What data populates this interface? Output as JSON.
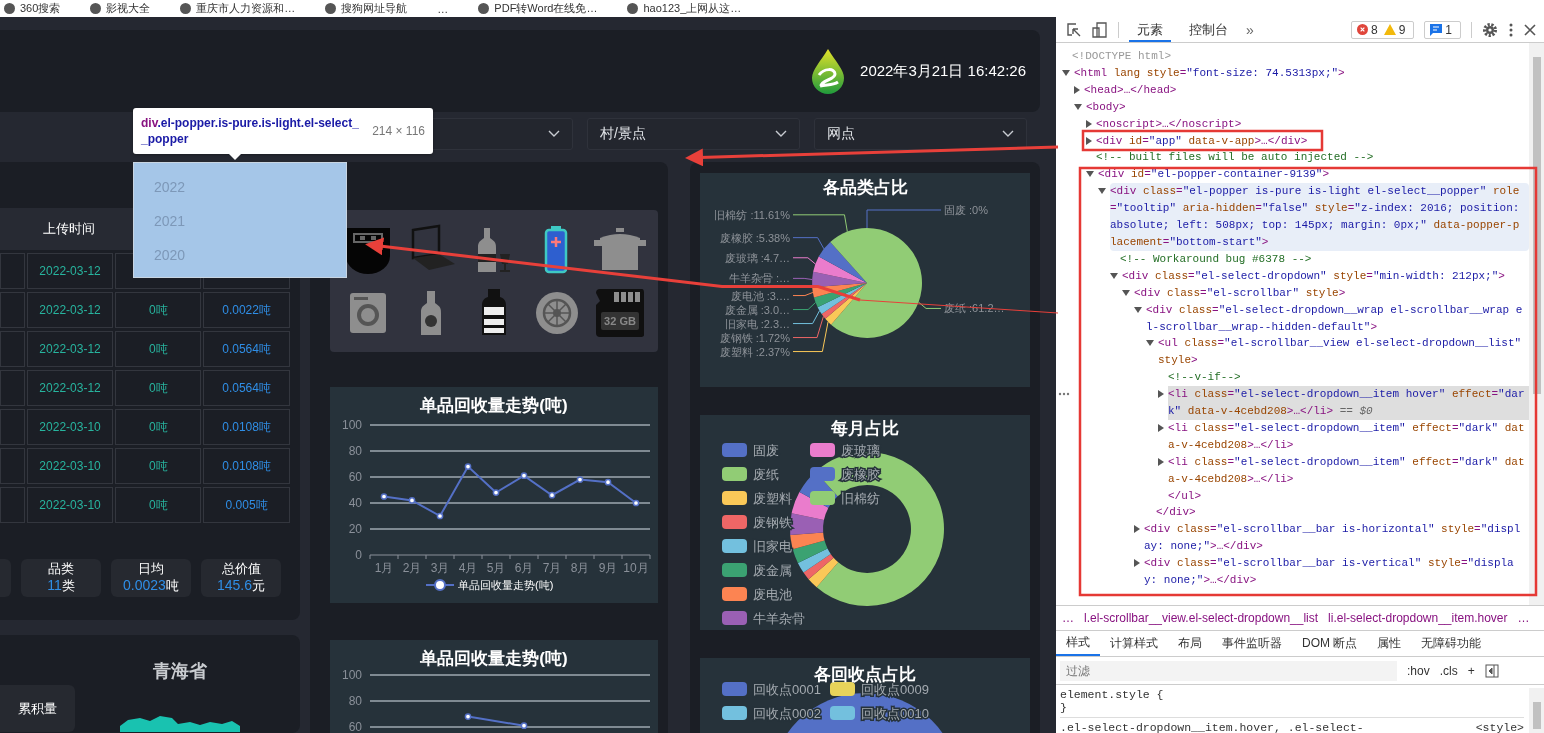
{
  "bookmarks": [
    {
      "label": "360搜索",
      "icon": true
    },
    {
      "label": "影视大全",
      "icon": true
    },
    {
      "label": "重庆市人力资源和…",
      "icon": true
    },
    {
      "label": "搜狗网址导航",
      "icon": true
    },
    {
      "label": "…",
      "icon": false
    },
    {
      "label": "PDF转Word在线免…",
      "icon": true
    },
    {
      "label": "hao123_上网从这…",
      "icon": true
    }
  ],
  "header": {
    "datetime": "2022年3月21日 16:42:26"
  },
  "filters": [
    {
      "kind": "blank"
    },
    {
      "kind": "blank"
    },
    {
      "kind": "text",
      "value": "村/景点"
    },
    {
      "kind": "text",
      "value": "网点"
    }
  ],
  "inspect_tooltip": {
    "selector": "div.el-popper.is-pure.is-light.el-select__popper",
    "size": "214 × 116"
  },
  "year_dropdown": {
    "options": [
      {
        "label": "2022",
        "selected": false
      },
      {
        "label": "2021",
        "selected": false
      },
      {
        "label": "2020",
        "selected": false
      }
    ]
  },
  "upload_table": {
    "columns": [
      "上传时间"
    ],
    "rows": [
      {
        "cells": [
          "2022-03-12"
        ]
      },
      {
        "cells": [
          "2022-03-12",
          "0吨",
          "0.0022吨"
        ]
      },
      {
        "cells": [
          "2022-03-12",
          "0吨",
          "0.0564吨"
        ]
      },
      {
        "cells": [
          "2022-03-12",
          "0吨",
          "0.0564吨"
        ]
      },
      {
        "cells": [
          "2022-03-10",
          "0吨",
          "0.0108吨"
        ]
      },
      {
        "cells": [
          "2022-03-10",
          "0吨",
          "0.0108吨"
        ]
      },
      {
        "cells": [
          "2022-03-10",
          "0吨",
          "0.005吨"
        ]
      }
    ]
  },
  "stats": [
    {
      "kind": "blank"
    },
    {
      "kind": "stat",
      "label": "品类",
      "value": "11",
      "unit": "类"
    },
    {
      "kind": "stat",
      "label": "日均",
      "value": "0.0023",
      "unit": "吨"
    },
    {
      "kind": "stat",
      "label": "总价值",
      "value": "145.6",
      "unit": "元"
    }
  ],
  "map_panel": {
    "title": "青海省",
    "button": "累积量"
  },
  "category_icons": [
    {
      "kind": "drive"
    },
    {
      "kind": "laptop"
    },
    {
      "kind": "bottle-glass"
    },
    {
      "kind": "battery"
    },
    {
      "kind": "pot"
    },
    {
      "kind": "washer"
    },
    {
      "kind": "bottle"
    },
    {
      "kind": "water-bottle"
    },
    {
      "kind": "tire"
    },
    {
      "kind": "sdcard",
      "label": "32 GB"
    }
  ],
  "trend_charts": [
    {
      "chart_data": {
        "type": "line",
        "title": "单品回收量走势(吨)",
        "categories": [
          "1月",
          "2月",
          "3月",
          "4月",
          "5月",
          "6月",
          "7月",
          "8月",
          "9月",
          "10月"
        ],
        "ylim": [
          0,
          100
        ],
        "yticks": [
          0,
          20,
          40,
          60,
          80,
          100
        ],
        "grid": true,
        "series": [
          {
            "name": "单品回收量走势(吨)",
            "color": "#5470c6",
            "marker": true,
            "values": [
              45,
              42,
              30,
              68,
              48,
              61,
              46,
              58,
              56,
              40
            ]
          }
        ]
      }
    },
    {
      "chart_data": {
        "type": "line",
        "title": "单品回收量走势(吨)",
        "ylim": [
          60,
          100
        ],
        "yticks": [
          60,
          80,
          100
        ],
        "grid": true,
        "series": [
          {
            "color": "#5470c6",
            "marker": true,
            "values": [
              null,
              null,
              null,
              68,
              null,
              61,
              null,
              null,
              null,
              null
            ]
          }
        ]
      }
    }
  ],
  "category_pie": {
    "chart_data": {
      "type": "pie",
      "title": "各品类占比",
      "values": [
        0,
        61.2,
        2.37,
        1.72,
        2.3,
        3.0,
        3.0,
        4.5,
        4.7,
        5.38,
        11.61
      ],
      "colors": [
        "#5470c6",
        "#91cc75",
        "#fac858",
        "#ee6666",
        "#73c0de",
        "#3ba272",
        "#fc8452",
        "#9a60b4",
        "#ea7ccc",
        "#5470c6",
        "#91cc75"
      ],
      "value_labels": [
        "固废 :0%",
        "废纸 :61.2…",
        "废塑料 :2.37%",
        "废钢铁 :1.72%",
        "旧家电 :2.3…",
        "废金属 :3.0…",
        "废电池 :3.…",
        "牛羊杂骨 :…",
        "废玻璃 :4.7…",
        "废橡胶 :5.38%",
        "旧棉纺 :11.61%"
      ]
    }
  },
  "monthly_donut": {
    "title": "每月占比",
    "legend": [
      {
        "label": "固废",
        "color": "#5470c6"
      },
      {
        "label": "废纸",
        "color": "#91cc75"
      },
      {
        "label": "废塑料",
        "color": "#fac858"
      },
      {
        "label": "废钢铁",
        "color": "#ee6666"
      },
      {
        "label": "旧家电",
        "color": "#73c0de"
      },
      {
        "label": "废金属",
        "color": "#3ba272"
      },
      {
        "label": "废电池",
        "color": "#fc8452"
      },
      {
        "label": "牛羊杂骨",
        "color": "#9a60b4"
      },
      {
        "label": "废玻璃",
        "color": "#ea7ccc"
      },
      {
        "label": "废橡胶",
        "color": "#5470c6"
      },
      {
        "label": "旧棉纺",
        "color": "#91cc75"
      }
    ]
  },
  "station_pie": {
    "title": "各回收点占比",
    "legend": [
      {
        "label": "回收点0001",
        "color": "#5470c6"
      },
      {
        "label": "回收点0002",
        "color": "#73c0de"
      },
      {
        "label": "回收点0009",
        "color": "#e8d35a"
      },
      {
        "label": "回收点0010",
        "color": "#73c0de"
      }
    ]
  },
  "devtools": {
    "tabs": [
      {
        "label": "元素",
        "selected": true
      },
      {
        "label": "控制台",
        "selected": false
      }
    ],
    "more_tabs": "»",
    "errors": "8",
    "warnings": "9",
    "messages": "1",
    "dom": [
      {
        "kind": "text",
        "text": "<!DOCTYPE html>",
        "selected": false,
        "hovered": false
      },
      {
        "kind": "element",
        "text": "<html lang style=\"font-size: 74.5313px;\">",
        "expanded": true,
        "selected": false,
        "hovered": false,
        "children": [
          {
            "kind": "element",
            "text": "<head>…</head>",
            "expanded": false,
            "selected": false,
            "hovered": false
          },
          {
            "kind": "element",
            "text": "<body>",
            "expanded": true,
            "selected": false,
            "hovered": false,
            "children": [
              {
                "kind": "element",
                "text": "<noscript>…</noscript>",
                "expanded": false,
                "selected": false,
                "hovered": false
              },
              {
                "kind": "element",
                "text": "<div id=\"app\" data-v-app>…</div>",
                "expanded": false,
                "selected": false,
                "hovered": false
              },
              {
                "kind": "text",
                "text": "<!-- built files will be auto injected -->",
                "selected": false,
                "hovered": false
              },
              {
                "kind": "element",
                "text": "<div id=\"el-popper-container-9139\">",
                "expanded": true,
                "selected": false,
                "hovered": false,
                "children": [
                  {
                    "kind": "element",
                    "text": "<div class=\"el-popper is-pure is-light el-select__popper\" role=\"tooltip\" aria-hidden=\"false\" style=\"z-index: 2016; position: absolute; left: 508px; top: 145px; margin: 0px;\" data-popper-placement=\"bottom-start\">",
                    "expanded": true,
                    "selected": false,
                    "hovered": true,
                    "children": [
                      {
                        "kind": "text",
                        "text": "<!-- Workaround bug #6378 -->",
                        "selected": false,
                        "hovered": false
                      },
                      {
                        "kind": "element",
                        "text": "<div class=\"el-select-dropdown\" style=\"min-width: 212px;\">",
                        "expanded": true,
                        "selected": false,
                        "hovered": false,
                        "children": [
                          {
                            "kind": "element",
                            "text": "<div class=\"el-scrollbar\" style>",
                            "expanded": true,
                            "selected": false,
                            "hovered": false,
                            "children": [
                              {
                                "kind": "element",
                                "text": "<div class=\"el-select-dropdown__wrap el-scrollbar__wrap el-scrollbar__wrap--hidden-default\">",
                                "expanded": true,
                                "selected": false,
                                "hovered": false,
                                "children": [
                                  {
                                    "kind": "element",
                                    "text": "<ul class=\"el-scrollbar__view el-select-dropdown__list\" style>",
                                    "expanded": true,
                                    "selected": false,
                                    "hovered": false,
                                    "children": [
                                      {
                                        "kind": "text",
                                        "text": "<!--v-if-->",
                                        "selected": false,
                                        "hovered": false
                                      },
                                      {
                                        "kind": "element",
                                        "text": "<li class=\"el-select-dropdown__item hover\" effect=\"dark\" data-v-4cebd208>…</li>",
                                        "suffix": "== $0",
                                        "expanded": false,
                                        "selected": true,
                                        "hovered": false
                                      },
                                      {
                                        "kind": "element",
                                        "text": "<li class=\"el-select-dropdown__item\" effect=\"dark\" data-v-4cebd208>…</li>",
                                        "expanded": false,
                                        "selected": false,
                                        "hovered": false
                                      },
                                      {
                                        "kind": "element",
                                        "text": "<li class=\"el-select-dropdown__item\" effect=\"dark\" data-v-4cebd208>…</li>",
                                        "expanded": false,
                                        "selected": false,
                                        "hovered": false
                                      },
                                      {
                                        "kind": "text",
                                        "text": "</ul>",
                                        "selected": false,
                                        "hovered": false
                                      }
                                    ]
                                  },
                                  {
                                    "kind": "text",
                                    "text": "</div>",
                                    "selected": false,
                                    "hovered": false
                                  }
                                ]
                              },
                              {
                                "kind": "element",
                                "text": "<div class=\"el-scrollbar__bar is-horizontal\" style=\"display: none;\">…</div>",
                                "expanded": false,
                                "selected": false,
                                "hovered": false
                              },
                              {
                                "kind": "element",
                                "text": "<div class=\"el-scrollbar__bar is-vertical\" style=\"display: none;\">…</div>",
                                "expanded": false,
                                "selected": false,
                                "hovered": false
                              }
                            ]
                          }
                        ]
                      }
                    ]
                  }
                ]
              }
            ]
          }
        ]
      }
    ],
    "breadcrumbs": [
      "…",
      "l.el-scrollbar__view.el-select-dropdown__list",
      "li.el-select-dropdown__item.hover",
      "…"
    ],
    "style_tabs": [
      {
        "label": "样式",
        "selected": true
      },
      {
        "label": "计算样式",
        "selected": false
      },
      {
        "label": "布局",
        "selected": false
      },
      {
        "label": "事件监听器",
        "selected": false
      },
      {
        "label": "DOM 断点",
        "selected": false
      },
      {
        "label": "属性",
        "selected": false
      },
      {
        "label": "无障碍功能",
        "selected": false
      }
    ],
    "filter": {
      "placeholder": "过滤"
    },
    "style_buttons": [
      ":hov",
      ".cls",
      "+"
    ],
    "rules": [
      {
        "selector": "element.style {",
        "close": "}"
      },
      {
        "selector": ".el-select-dropdown__item.hover, .el-select-",
        "source": "<style>"
      }
    ]
  }
}
